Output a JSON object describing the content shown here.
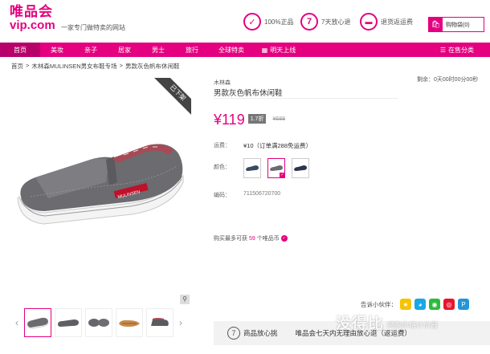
{
  "header": {
    "logo_cn": "唯品会",
    "logo_en": "vip.com",
    "slogan": "一家专门做特卖的网站",
    "badges": [
      {
        "icon": "shield-icon",
        "glyph": "✓",
        "label": "100%正品"
      },
      {
        "icon": "seven-icon",
        "glyph": "7",
        "label": "7天放心退"
      },
      {
        "icon": "card-icon",
        "glyph": "▬",
        "label": "退货返运费"
      }
    ],
    "cart": {
      "icon": "cart-icon",
      "label": "购物袋(0)"
    }
  },
  "nav": {
    "items": [
      "首页",
      "美妆",
      "亲子",
      "居家",
      "男士",
      "旅行",
      "全球特卖"
    ],
    "tomorrow": "明天上线",
    "on_sale": "在售分类"
  },
  "breadcrumb": [
    "首页",
    ">",
    "木林森MULINSEN男女布鞋专场",
    ">",
    "男款灰色帆布休闲鞋"
  ],
  "product": {
    "ribbon": "已下架",
    "brand": "木林森",
    "title": "男款灰色帆布休闲鞋",
    "countdown": "剩余：0天00时00分00秒",
    "price": "¥119",
    "discount": "1.7折",
    "original_price": "¥689",
    "shipping_label": "运费：",
    "shipping_value": "¥10（订单满288免运费）",
    "color_label": "颜色：",
    "code_label": "编码：",
    "code_value": "711506720700",
    "limit_prefix": "购买最多可获",
    "limit_num": "59",
    "limit_suffix": "个唯品币"
  },
  "share": {
    "label": "告诉小伙伴："
  },
  "promise": {
    "circle": "7",
    "title": "商品放心挑",
    "text": "唯品会七天内无理由放心退（返运费）"
  },
  "watermark": {
    "main": "没得比",
    "sub": "网购价格计价器"
  }
}
